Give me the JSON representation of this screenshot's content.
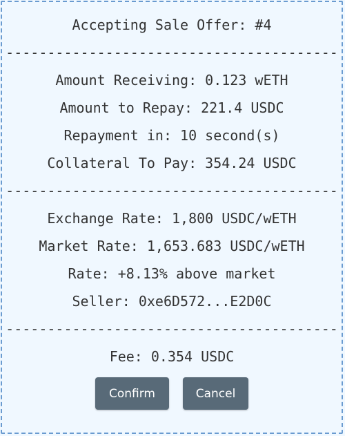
{
  "dialog": {
    "title": "Accepting Sale Offer: #4",
    "separator": "----------------------------------------",
    "amount_receiving": "Amount Receiving: 0.123 wETH",
    "amount_to_repay": "Amount to Repay: 221.4 USDC",
    "repayment_in": "Repayment in: 10 second(s)",
    "collateral_to_pay": "Collateral To Pay: 354.24 USDC",
    "exchange_rate": "Exchange Rate: 1,800 USDC/wETH",
    "market_rate": "Market Rate: 1,653.683 USDC/wETH",
    "rate_diff": "Rate: +8.13% above market",
    "seller": "Seller: 0xe6D572...E2D0C",
    "fee": "Fee: 0.354 USDC",
    "confirm_label": "Confirm",
    "cancel_label": "Cancel"
  },
  "colors": {
    "background": "#f0f8ff",
    "border": "#6a9bd0",
    "text": "#333333",
    "button": "#586a78",
    "button_text": "#ffffff"
  }
}
